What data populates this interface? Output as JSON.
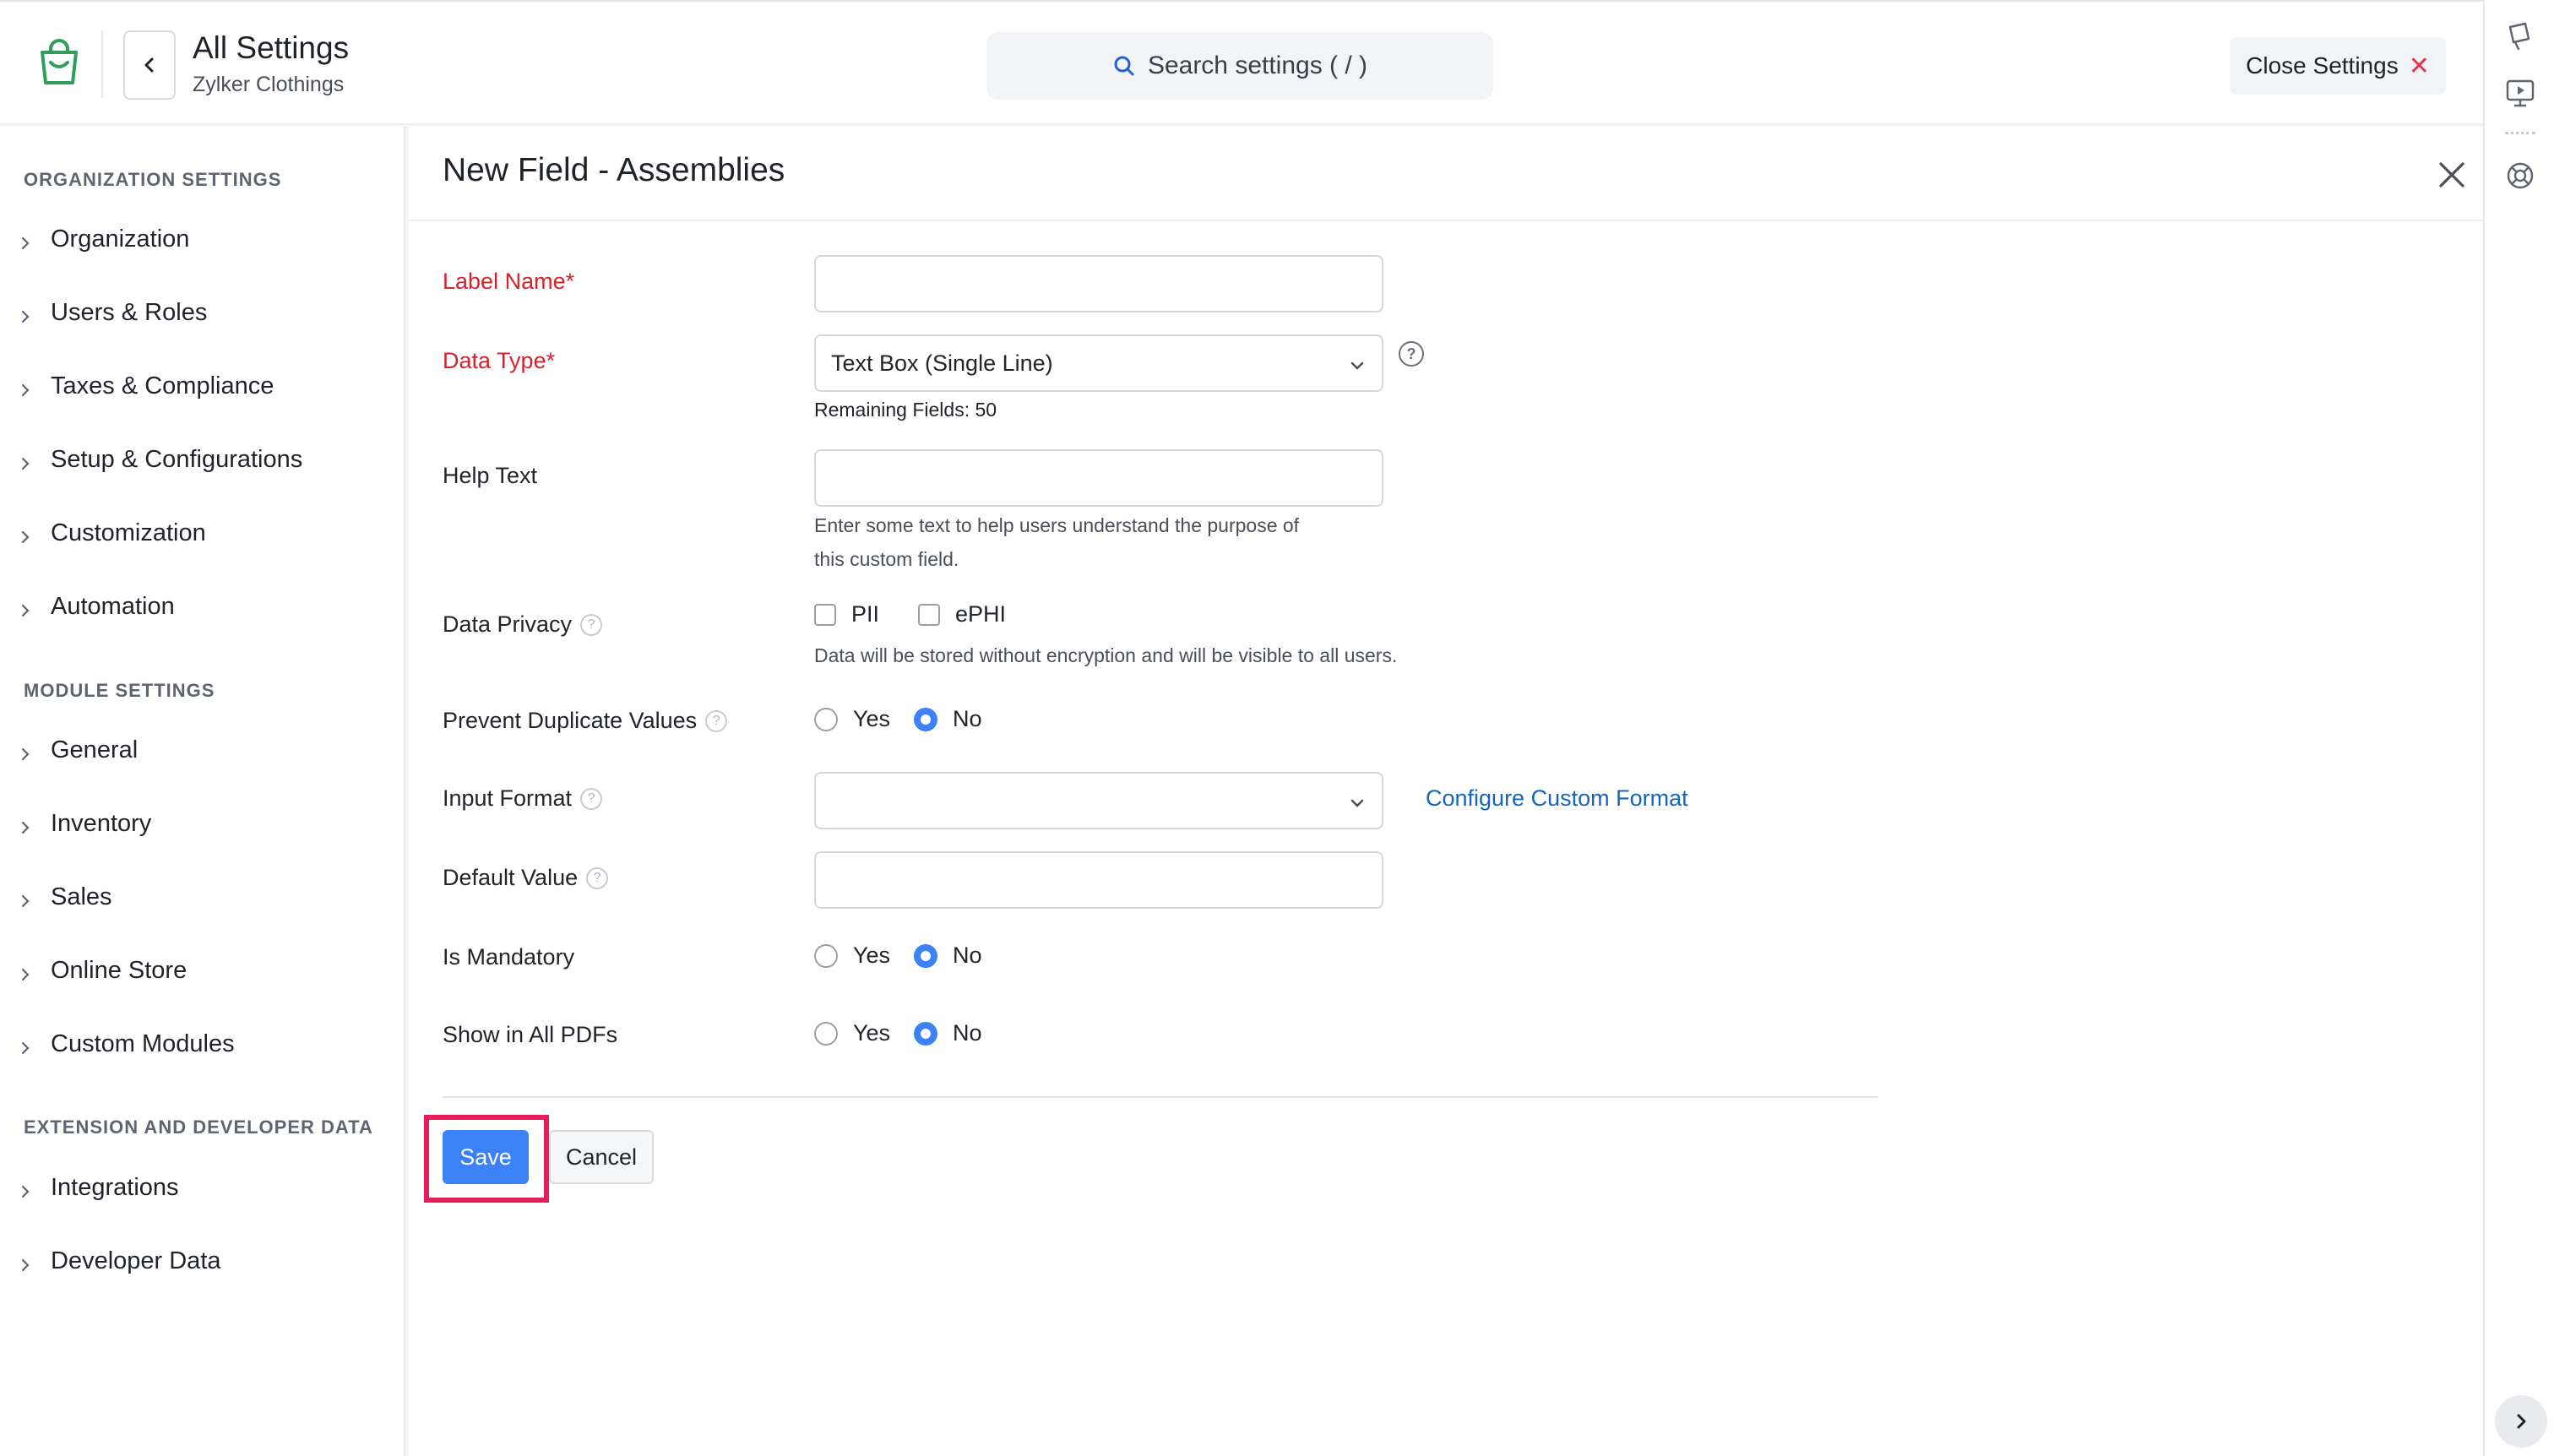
{
  "header": {
    "title": "All Settings",
    "subtitle": "Zylker Clothings",
    "search_placeholder": "Search settings ( / )",
    "close_settings_label": "Close Settings",
    "close_symbol": "✕"
  },
  "sidebar": {
    "sections": [
      {
        "heading": "ORGANIZATION SETTINGS",
        "items": [
          "Organization",
          "Users & Roles",
          "Taxes & Compliance",
          "Setup & Configurations",
          "Customization",
          "Automation"
        ]
      },
      {
        "heading": "MODULE SETTINGS",
        "items": [
          "General",
          "Inventory",
          "Sales",
          "Online Store",
          "Custom Modules"
        ]
      },
      {
        "heading": "EXTENSION AND DEVELOPER DATA",
        "items": [
          "Integrations",
          "Developer Data"
        ]
      }
    ]
  },
  "form": {
    "title": "New Field - Assemblies",
    "label_name": {
      "label": "Label Name*",
      "value": ""
    },
    "data_type": {
      "label": "Data Type*",
      "value": "Text Box (Single Line)",
      "remaining": "Remaining Fields: 50"
    },
    "help_text": {
      "label": "Help Text",
      "value": "",
      "hint_line1": "Enter some text to help users understand the purpose of",
      "hint_line2": "this custom field."
    },
    "data_privacy": {
      "label": "Data Privacy",
      "opt1": "PII",
      "opt2": "ePHI",
      "note": "Data will be stored without encryption and will be visible to all users."
    },
    "prevent_duplicates": {
      "label": "Prevent Duplicate Values",
      "yes": "Yes",
      "no": "No",
      "selected": "No"
    },
    "input_format": {
      "label": "Input Format",
      "value": "",
      "link": "Configure Custom Format"
    },
    "default_value": {
      "label": "Default Value",
      "value": ""
    },
    "is_mandatory": {
      "label": "Is Mandatory",
      "yes": "Yes",
      "no": "No",
      "selected": "No"
    },
    "show_in_pdfs": {
      "label": "Show in All PDFs",
      "yes": "Yes",
      "no": "No",
      "selected": "No"
    },
    "save_label": "Save",
    "cancel_label": "Cancel",
    "help_symbol": "?"
  },
  "colors": {
    "accent": "#3b82f6",
    "required": "#d6232b",
    "link": "#1565c0",
    "highlight": "#e41e5a",
    "brand": "#2e9e5b"
  }
}
